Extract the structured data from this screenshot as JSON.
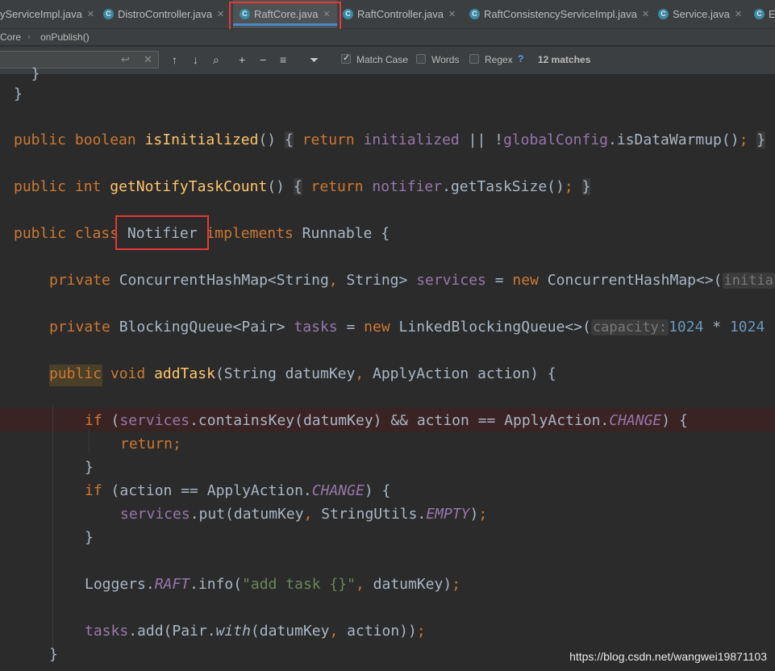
{
  "tabs": [
    {
      "label": "yServiceImpl.java",
      "active": false,
      "icon": "class-icon"
    },
    {
      "label": "DistroController.java",
      "active": false,
      "icon": "class-icon"
    },
    {
      "label": "RaftCore.java",
      "active": true,
      "icon": "class-icon"
    },
    {
      "label": "RaftController.java",
      "active": false,
      "icon": "class-icon"
    },
    {
      "label": "RaftConsistencyServiceImpl.java",
      "active": false,
      "icon": "class-icon"
    },
    {
      "label": "Service.java",
      "active": false,
      "icon": "class-icon"
    },
    {
      "label": "Ev",
      "active": false,
      "icon": "class-icon"
    }
  ],
  "breadcrumb": {
    "first": "Core",
    "second": "onPublish()"
  },
  "find": {
    "value": "",
    "match_case_label": "Match Case",
    "match_case_checked": true,
    "words_label": "Words",
    "words_checked": false,
    "regex_label": "Regex",
    "regex_checked": false,
    "help": "?",
    "matches": "12 matches"
  },
  "code": {
    "l0": "  }",
    "l1": "}",
    "l2_pub": "public",
    "l2_bool": "boolean",
    "l2_fn": "isInitialized",
    "l2_rest1": "()",
    "l2_ob": "{",
    "l2_ret": "return",
    "l2_fld": "initialized",
    "l2_op": " || !",
    "l2_fld2": "globalConfig",
    "l2_call": ".isDataWarmup()",
    "l2_semi": ";",
    "l2_cb": "}",
    "l3_pub": "public",
    "l3_int": "int",
    "l3_fn": "getNotifyTaskCount",
    "l3_rest1": "()",
    "l3_ob": "{",
    "l3_ret": "return",
    "l3_fld": "notifier",
    "l3_call": ".getTaskSize()",
    "l3_semi": ";",
    "l3_cb": "}",
    "l4_pub": "public",
    "l4_cls": "class",
    "l4_name": "Notifier",
    "l4_impl": "implements",
    "l4_rest": "Runnable {",
    "l5_priv": "private",
    "l5_type": "ConcurrentHashMap<String",
    "l5_comma": ",",
    "l5_type2": "String> ",
    "l5_fld": "services",
    "l5_eq": " = ",
    "l5_new": "new",
    "l5_ctor": "ConcurrentHashMap<>(",
    "l5_hint": "initia",
    "l6_priv": "private",
    "l6_type": "BlockingQueue<Pair> ",
    "l6_fld": "tasks",
    "l6_eq": " = ",
    "l6_new": "new",
    "l6_ctor": "LinkedBlockingQueue<>(",
    "l6_hint": "capacity:",
    "l6_n1": "1024",
    "l6_op": " * ",
    "l6_n2": "1024",
    "l7_pub": "public",
    "l7_void": "void",
    "l7_fn": "addTask",
    "l7_p1": "(String datumKey",
    "l7_comma": ",",
    "l7_p2": " ApplyAction action) {",
    "l8_if": "if",
    "l8_a": " (",
    "l8_fld": "services",
    "l8_b": ".containsKey(datumKey) && action == ApplyAction.",
    "l8_cst": "CHANGE",
    "l8_c": ") {",
    "l9_ret": "return",
    "l9_semi": ";",
    "l10": "}",
    "l11_if": "if",
    "l11_a": " (action == ApplyAction.",
    "l11_cst": "CHANGE",
    "l11_c": ") {",
    "l12_fld": "services",
    "l12_a": ".put(datumKey",
    "l12_comma": ",",
    "l12_b": " StringUtils.",
    "l12_cst": "EMPTY",
    "l12_c": ")",
    "l12_semi": ";",
    "l13": "}",
    "l14_a": "Loggers.",
    "l14_cst": "RAFT",
    "l14_b": ".info(",
    "l14_str": "\"add task {}\"",
    "l14_comma": ",",
    "l14_c": " datumKey)",
    "l14_semi": ";",
    "l15_fld": "tasks",
    "l15_a": ".add(Pair.",
    "l15_sm": "with",
    "l15_b": "(datumKey",
    "l15_comma": ",",
    "l15_c": " action))",
    "l15_semi": ";",
    "l16": "}"
  },
  "watermark": "https://blog.csdn.net/wangwei19871103",
  "colors": {
    "keyword": "#cc7832",
    "method": "#ffc66d",
    "field": "#9876aa",
    "string": "#6a8759",
    "number": "#6897bb",
    "highlight_box": "#e53935"
  }
}
